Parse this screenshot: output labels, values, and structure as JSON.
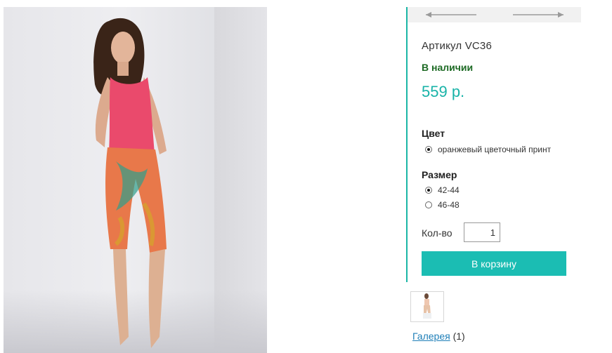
{
  "product": {
    "sku": "Артикул VC36",
    "stock": "В наличии",
    "price": "559 р.",
    "image_icon": "model-in-pink-top-and-floral-leggings"
  },
  "nav": {
    "prev_icon": "arrow-left-icon",
    "next_icon": "arrow-right-icon"
  },
  "options": {
    "color": {
      "title": "Цвет",
      "items": [
        {
          "label": "оранжевый цветочный принт",
          "checked": true
        }
      ]
    },
    "size": {
      "title": "Размер",
      "items": [
        {
          "label": "42-44",
          "checked": true
        },
        {
          "label": "46-48",
          "checked": false
        }
      ]
    }
  },
  "quantity": {
    "label": "Кол-во",
    "value": "1"
  },
  "cart_button": "В корзину",
  "gallery": {
    "link": "Галерея",
    "count": "(1)"
  },
  "colors": {
    "accent": "#1bbdb3",
    "price": "#19b3a8",
    "stock": "#1d6a24",
    "link": "#1f7fb8"
  }
}
